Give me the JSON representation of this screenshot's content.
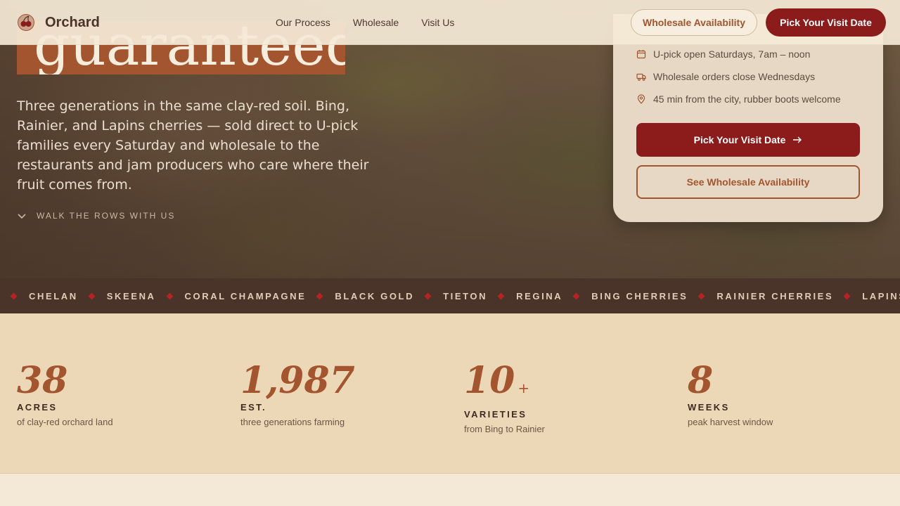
{
  "nav": {
    "brand": "Orchard",
    "links": [
      "Our Process",
      "Wholesale",
      "Visit Us"
    ],
    "outline_button": "Wholesale Availability",
    "primary_button": "Pick Your Visit Date"
  },
  "hero": {
    "headline": "guaranteed.",
    "description": "Three generations in the same clay-red soil. Bing, Rainier, and Lapins cherries — sold direct to U-pick families every Saturday and wholesale to the restaurants and jam producers who care where their fruit comes from.",
    "walk_link": "WALK THE ROWS WITH US"
  },
  "visit_card": {
    "items": [
      {
        "icon": "calendar-icon",
        "text": "U-pick open Saturdays, 7am – noon"
      },
      {
        "icon": "truck-icon",
        "text": "Wholesale orders close Wednesdays"
      },
      {
        "icon": "map-pin-icon",
        "text": "45 min from the city, rubber boots welcome"
      }
    ],
    "primary_button": "Pick Your Visit Date",
    "outline_button": "See Wholesale Availability"
  },
  "ticker": [
    "CHELAN",
    "SKEENA",
    "CORAL CHAMPAGNE",
    "BLACK GOLD",
    "TIETON",
    "REGINA",
    "BING CHERRIES",
    "RAINIER CHERRIES",
    "LAPINS"
  ],
  "stats": [
    {
      "value": "38",
      "suffix": "",
      "label": "ACRES",
      "desc": "of clay-red orchard land"
    },
    {
      "value": "1,987",
      "suffix": "",
      "label": "EST.",
      "desc": "three generations farming"
    },
    {
      "value": "10",
      "suffix": "+",
      "label": "VARIETIES",
      "desc": "from Bing to Rainier"
    },
    {
      "value": "8",
      "suffix": "",
      "label": "WEEKS",
      "desc": "peak harvest window"
    }
  ],
  "colors": {
    "brand_red": "#8c1c1c",
    "rust": "#a3552f",
    "dark_brown": "#4a3328",
    "cream": "#f4e9d6"
  }
}
